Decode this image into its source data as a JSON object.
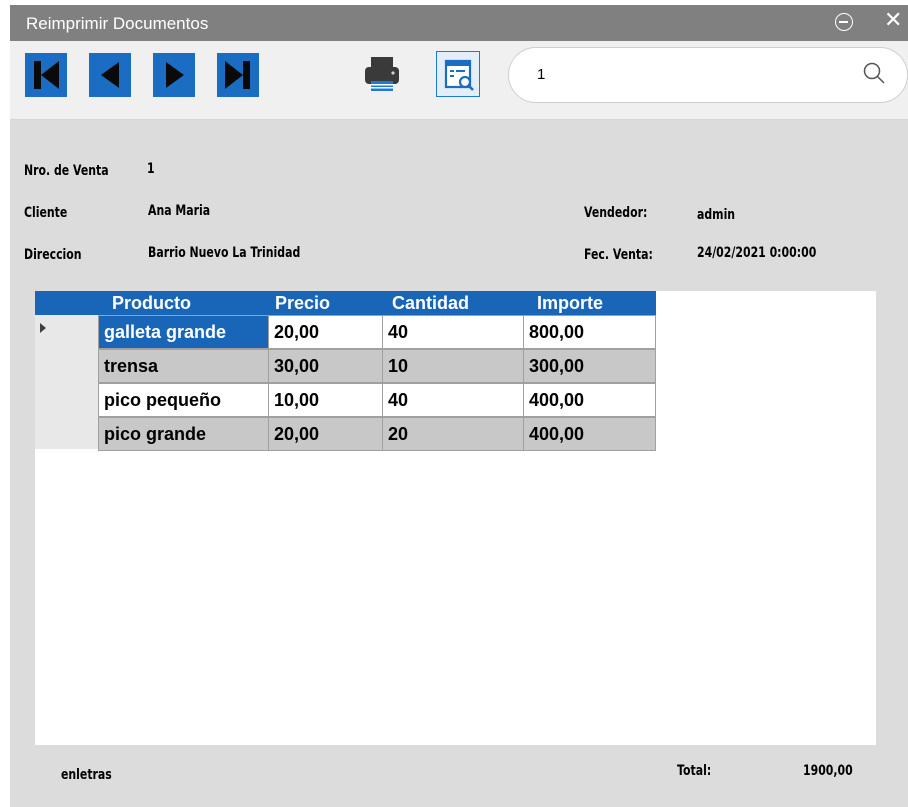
{
  "window": {
    "title": "Reimprimir Documentos"
  },
  "toolbar": {
    "buttons": [
      "first-record",
      "previous-record",
      "next-record",
      "last-record",
      "print",
      "print-preview"
    ],
    "search": {
      "value": "1",
      "placeholder": ""
    }
  },
  "sale": {
    "nro_label": "Nro. de Venta",
    "nro_value": "1",
    "cliente_label": "Cliente",
    "cliente_value": "Ana Maria",
    "direccion_label": "Direccion",
    "direccion_value": "Barrio Nuevo La Trinidad",
    "vendedor_label": "Vendedor:",
    "vendedor_value": "admin",
    "fecha_label": "Fec. Venta:",
    "fecha_value": "24/02/2021 0:00:00"
  },
  "table": {
    "headers": [
      "Producto",
      "Precio",
      "Cantidad",
      "Importe"
    ],
    "rows": [
      [
        "galleta grande",
        "20,00",
        "40",
        "800,00"
      ],
      [
        "trensa",
        "30,00",
        "10",
        "300,00"
      ],
      [
        "pico pequeño",
        "10,00",
        "40",
        "400,00"
      ],
      [
        "pico grande",
        "20,00",
        "20",
        "400,00"
      ]
    ],
    "selected_row": 0
  },
  "footer": {
    "letras_label": "enletras",
    "total_label": "Total:",
    "total_value": "1900,00"
  },
  "colors": {
    "accent": "#1966b9",
    "titlebar": "#808080",
    "alt_row": "#c8c8c8",
    "window_bg": "#dcdcdc"
  }
}
